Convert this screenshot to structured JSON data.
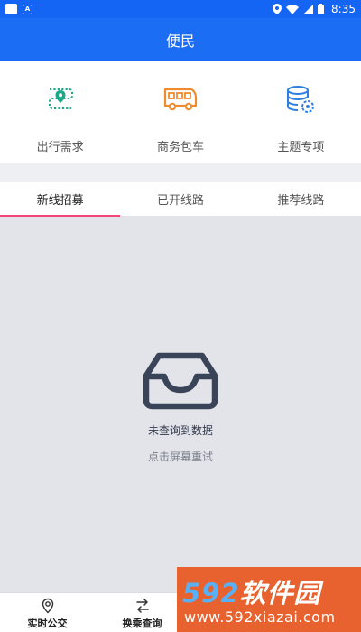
{
  "status_bar": {
    "time": "8:35",
    "left_icons": [
      "notification-icon",
      "app-a-icon"
    ],
    "right_icons": [
      "location-icon",
      "wifi-icon",
      "signal-icon",
      "battery-icon"
    ]
  },
  "header": {
    "title": "便民"
  },
  "quick_menu": [
    {
      "label": "出行需求",
      "icon": "route-map-icon",
      "color": "#1aa889"
    },
    {
      "label": "商务包车",
      "icon": "bus-icon",
      "color": "#f08a2e"
    },
    {
      "label": "主题专项",
      "icon": "database-gear-icon",
      "color": "#2f7fe0"
    }
  ],
  "tabs": [
    {
      "label": "新线招募",
      "active": true
    },
    {
      "label": "已开线路",
      "active": false
    },
    {
      "label": "推荐线路",
      "active": false
    }
  ],
  "empty_state": {
    "icon": "inbox-icon",
    "title": "未查询到数据",
    "hint": "点击屏幕重试"
  },
  "bottom_nav": [
    {
      "label": "实时公交",
      "icon": "location-pin-icon"
    },
    {
      "label": "换乘查询",
      "icon": "transfer-icon"
    }
  ],
  "watermark": {
    "number": "592",
    "name": "软件园",
    "url": "www.592xiazai.com"
  },
  "colors": {
    "primary": "#1b6ef3",
    "tab_indicator": "#f0467a",
    "content_bg": "#e3e4e9"
  }
}
